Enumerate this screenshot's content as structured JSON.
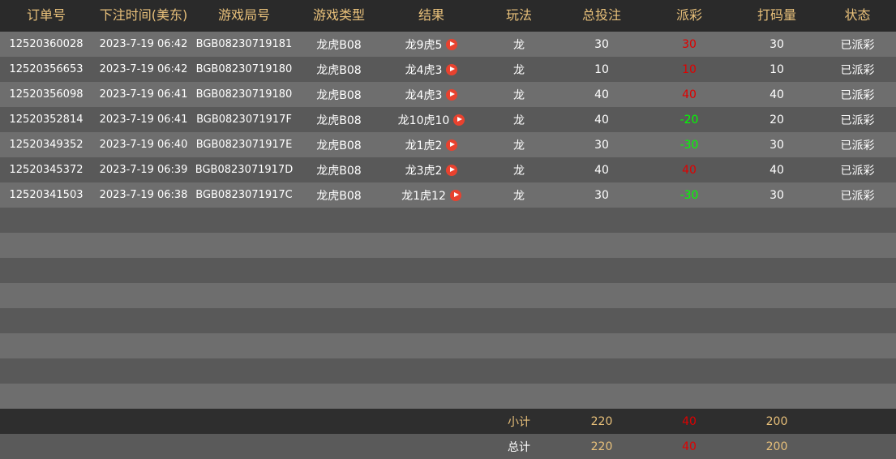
{
  "headers": [
    "订单号",
    "下注时间(美东)",
    "游戏局号",
    "游戏类型",
    "结果",
    "玩法",
    "总投注",
    "派彩",
    "打码量",
    "状态"
  ],
  "rows": [
    {
      "order": "12520360028",
      "time": "2023-7-19 06:42",
      "round": "BGB08230719181",
      "type": "龙虎B08",
      "result": "龙9虎5",
      "play": "龙",
      "bet": "30",
      "payout": "30",
      "payout_color": "red",
      "turnover": "30",
      "status": "已派彩"
    },
    {
      "order": "12520356653",
      "time": "2023-7-19 06:42",
      "round": "BGB08230719180",
      "type": "龙虎B08",
      "result": "龙4虎3",
      "play": "龙",
      "bet": "10",
      "payout": "10",
      "payout_color": "red",
      "turnover": "10",
      "status": "已派彩"
    },
    {
      "order": "12520356098",
      "time": "2023-7-19 06:41",
      "round": "BGB08230719180",
      "type": "龙虎B08",
      "result": "龙4虎3",
      "play": "龙",
      "bet": "40",
      "payout": "40",
      "payout_color": "red",
      "turnover": "40",
      "status": "已派彩"
    },
    {
      "order": "12520352814",
      "time": "2023-7-19 06:41",
      "round": "BGB0823071917F",
      "type": "龙虎B08",
      "result": "龙10虎10",
      "play": "龙",
      "bet": "40",
      "payout": "-20",
      "payout_color": "green",
      "turnover": "20",
      "status": "已派彩"
    },
    {
      "order": "12520349352",
      "time": "2023-7-19 06:40",
      "round": "BGB0823071917E",
      "type": "龙虎B08",
      "result": "龙1虎2",
      "play": "龙",
      "bet": "30",
      "payout": "-30",
      "payout_color": "green",
      "turnover": "30",
      "status": "已派彩"
    },
    {
      "order": "12520345372",
      "time": "2023-7-19 06:39",
      "round": "BGB0823071917D",
      "type": "龙虎B08",
      "result": "龙3虎2",
      "play": "龙",
      "bet": "40",
      "payout": "40",
      "payout_color": "red",
      "turnover": "40",
      "status": "已派彩"
    },
    {
      "order": "12520341503",
      "time": "2023-7-19 06:38",
      "round": "BGB0823071917C",
      "type": "龙虎B08",
      "result": "龙1虎12",
      "play": "龙",
      "bet": "30",
      "payout": "-30",
      "payout_color": "green",
      "turnover": "30",
      "status": "已派彩"
    }
  ],
  "subtotal": {
    "label": "小计",
    "bet": "220",
    "payout": "40",
    "turnover": "200"
  },
  "total": {
    "label": "总计",
    "bet": "220",
    "payout": "40",
    "turnover": "200"
  },
  "colors": {
    "header_bg": "#2a2a2a",
    "header_text": "#e8c07a",
    "row_odd": "#6e6e6e",
    "row_even": "#595959",
    "red": "#e00000",
    "green": "#00ff00"
  },
  "icons": {
    "result_video": "play-circle-icon"
  }
}
